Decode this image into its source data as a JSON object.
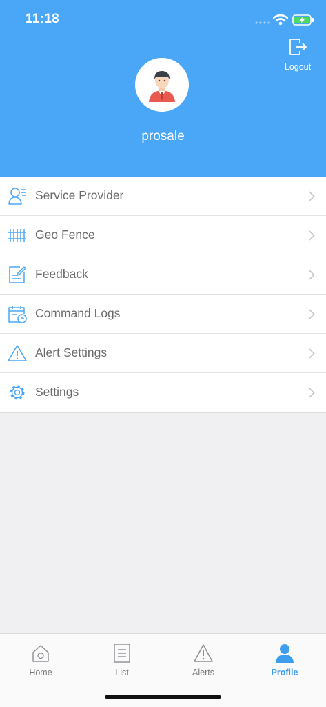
{
  "status_bar": {
    "time": "11:18"
  },
  "header": {
    "logout_label": "Logout",
    "username": "prosale",
    "accent": "#4aa7f8"
  },
  "menu": {
    "items": [
      {
        "label": "Service Provider",
        "icon": "service-provider-icon"
      },
      {
        "label": "Geo Fence",
        "icon": "geo-fence-icon"
      },
      {
        "label": "Feedback",
        "icon": "feedback-icon"
      },
      {
        "label": "Command Logs",
        "icon": "command-logs-icon"
      },
      {
        "label": "Alert Settings",
        "icon": "alert-icon"
      },
      {
        "label": "Settings",
        "icon": "gear-icon"
      }
    ]
  },
  "tabbar": {
    "tabs": [
      {
        "label": "Home",
        "icon": "home-icon",
        "active": false
      },
      {
        "label": "List",
        "icon": "list-icon",
        "active": false
      },
      {
        "label": "Alerts",
        "icon": "alert-icon",
        "active": false
      },
      {
        "label": "Profile",
        "icon": "profile-icon",
        "active": true
      }
    ],
    "active_color": "#3d9ef0"
  }
}
